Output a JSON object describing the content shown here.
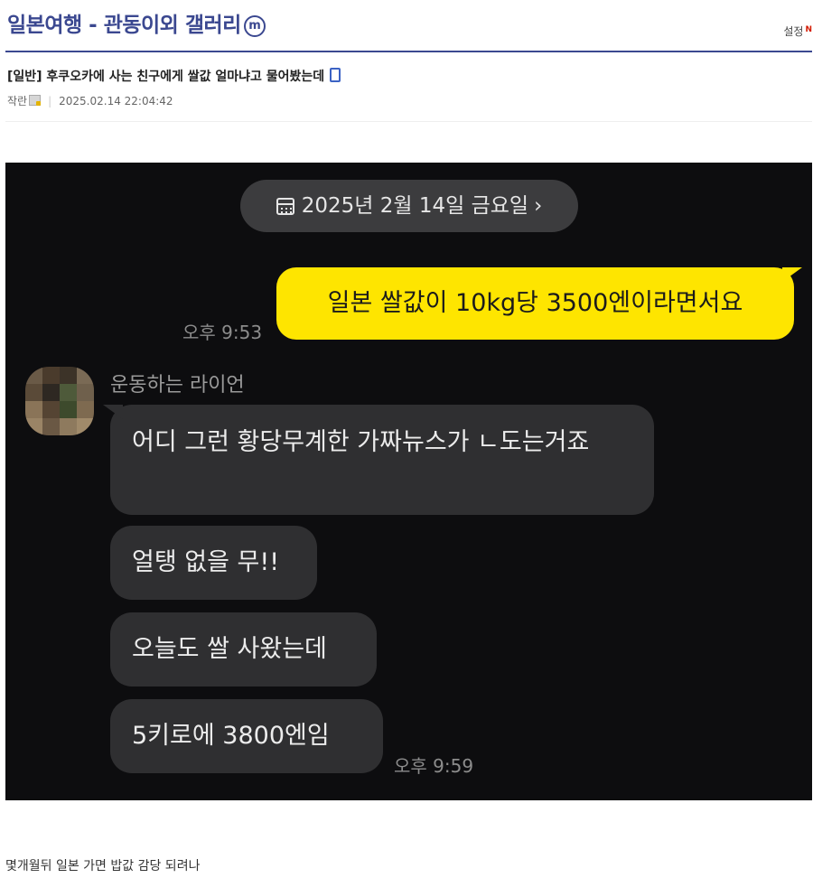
{
  "gallery": {
    "title": "일본여행 - 관동이외 갤러리",
    "minor_badge": "m",
    "settings_label": "설정",
    "new_mark": "N"
  },
  "post": {
    "title": "[일반] 후쿠오카에 사는 친구에게 쌀값 얼마냐고 물어봤는데",
    "author": "작란",
    "date": "2025.02.14 22:04:42",
    "body": "몇개월뒤 일본 가면 밥값 감당 되려나"
  },
  "chat_image": {
    "date_chip": "2025년 2월 14일 금요일",
    "date_chevron": "›",
    "sent_message": {
      "text": "일본 쌀값이 10kg당 3500엔이라면서요",
      "time": "오후 9:53"
    },
    "friend": {
      "name": "운동하는 라이언",
      "messages": [
        "어디 그런 황당무계한 가짜뉴스가 ㄴ도는거죠",
        "얼탱 없을 무!!",
        "오늘도 쌀 사왔는데",
        "5키로에 3800엔임"
      ],
      "time": "오후 9:59"
    }
  },
  "colors": {
    "gallery_accent": "#3b4890",
    "sent_bubble": "#fee500",
    "received_bubble": "#2f2f31",
    "chat_background": "#0d0d0f"
  },
  "icons": [
    "minor-gallery-icon",
    "mobile-icon",
    "user-fixed-nick-icon",
    "calendar-icon",
    "chevron-right-icon"
  ]
}
